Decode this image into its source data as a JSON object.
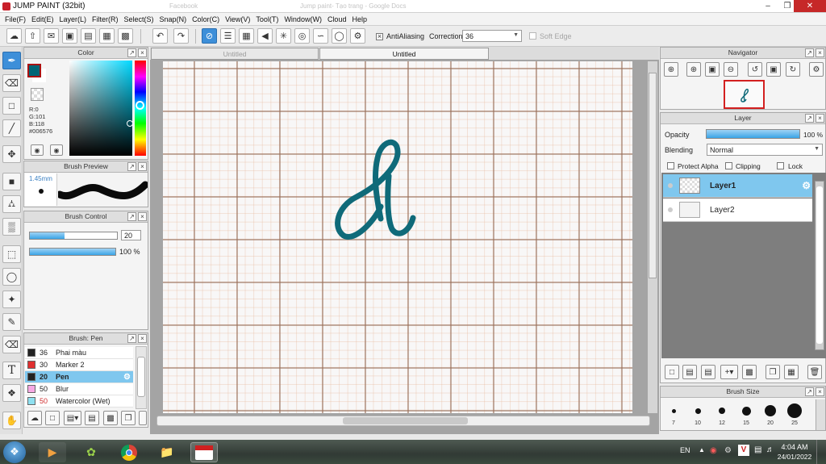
{
  "window": {
    "title": "JUMP PAINT (32bit)",
    "ghost_tabs": [
      "Facebook",
      "Jump paint- Tạo trang - Google Docs"
    ]
  },
  "menu": [
    "File(F)",
    "Edit(E)",
    "Layer(L)",
    "Filter(R)",
    "Select(S)",
    "Snap(N)",
    "Color(C)",
    "View(V)",
    "Tool(T)",
    "Window(W)",
    "Cloud",
    "Help"
  ],
  "toolbar": {
    "antialiasing_label": "AntiAliasing",
    "correction_label": "Correction",
    "correction_value": "36",
    "softedge_label": "Soft Edge"
  },
  "color_panel": {
    "title": "Color",
    "r": "R:0",
    "g": "G:101",
    "b": "B:118",
    "hex": "#006576",
    "current_color": "#006576"
  },
  "brush_preview": {
    "title": "Brush Preview",
    "size": "1.45mm"
  },
  "brush_control": {
    "title": "Brush Control",
    "size_value": "20",
    "size_fraction": 0.4,
    "opacity_value": "100 %",
    "opacity_fraction": 1.0
  },
  "brush_list": {
    "title": "Brush: Pen",
    "items": [
      {
        "size": "36",
        "name": "Phai màu",
        "color": "#222222",
        "size_color": "#222222"
      },
      {
        "size": "30",
        "name": "Marker 2",
        "color": "#e03030",
        "size_color": "#222222"
      },
      {
        "size": "20",
        "name": "Pen",
        "color": "#222222",
        "size_color": "#222222"
      },
      {
        "size": "50",
        "name": "Blur",
        "color": "#f7a8e4",
        "size_color": "#222222"
      },
      {
        "size": "50",
        "name": "Watercolor (Wet)",
        "color": "#8fe0f0",
        "size_color": "#d03030"
      }
    ]
  },
  "canvas": {
    "tabs": [
      "Untitled",
      "Untitled"
    ]
  },
  "navigator": {
    "title": "Navigator"
  },
  "layer_panel": {
    "title": "Layer",
    "opacity_label": "Opacity",
    "opacity_value": "100 %",
    "opacity_fraction": 1.0,
    "blending_label": "Blending",
    "blending_value": "Normal",
    "protect_alpha_label": "Protect Alpha",
    "clipping_label": "Clipping",
    "lock_label": "Lock",
    "layers": [
      {
        "name": "Layer1"
      },
      {
        "name": "Layer2"
      }
    ]
  },
  "brush_size_panel": {
    "title": "Brush Size",
    "sizes": [
      "7",
      "10",
      "12",
      "15",
      "20",
      "25"
    ]
  },
  "taskbar": {
    "lang": "EN",
    "time": "4:04 AM",
    "date": "24/01/2022"
  }
}
